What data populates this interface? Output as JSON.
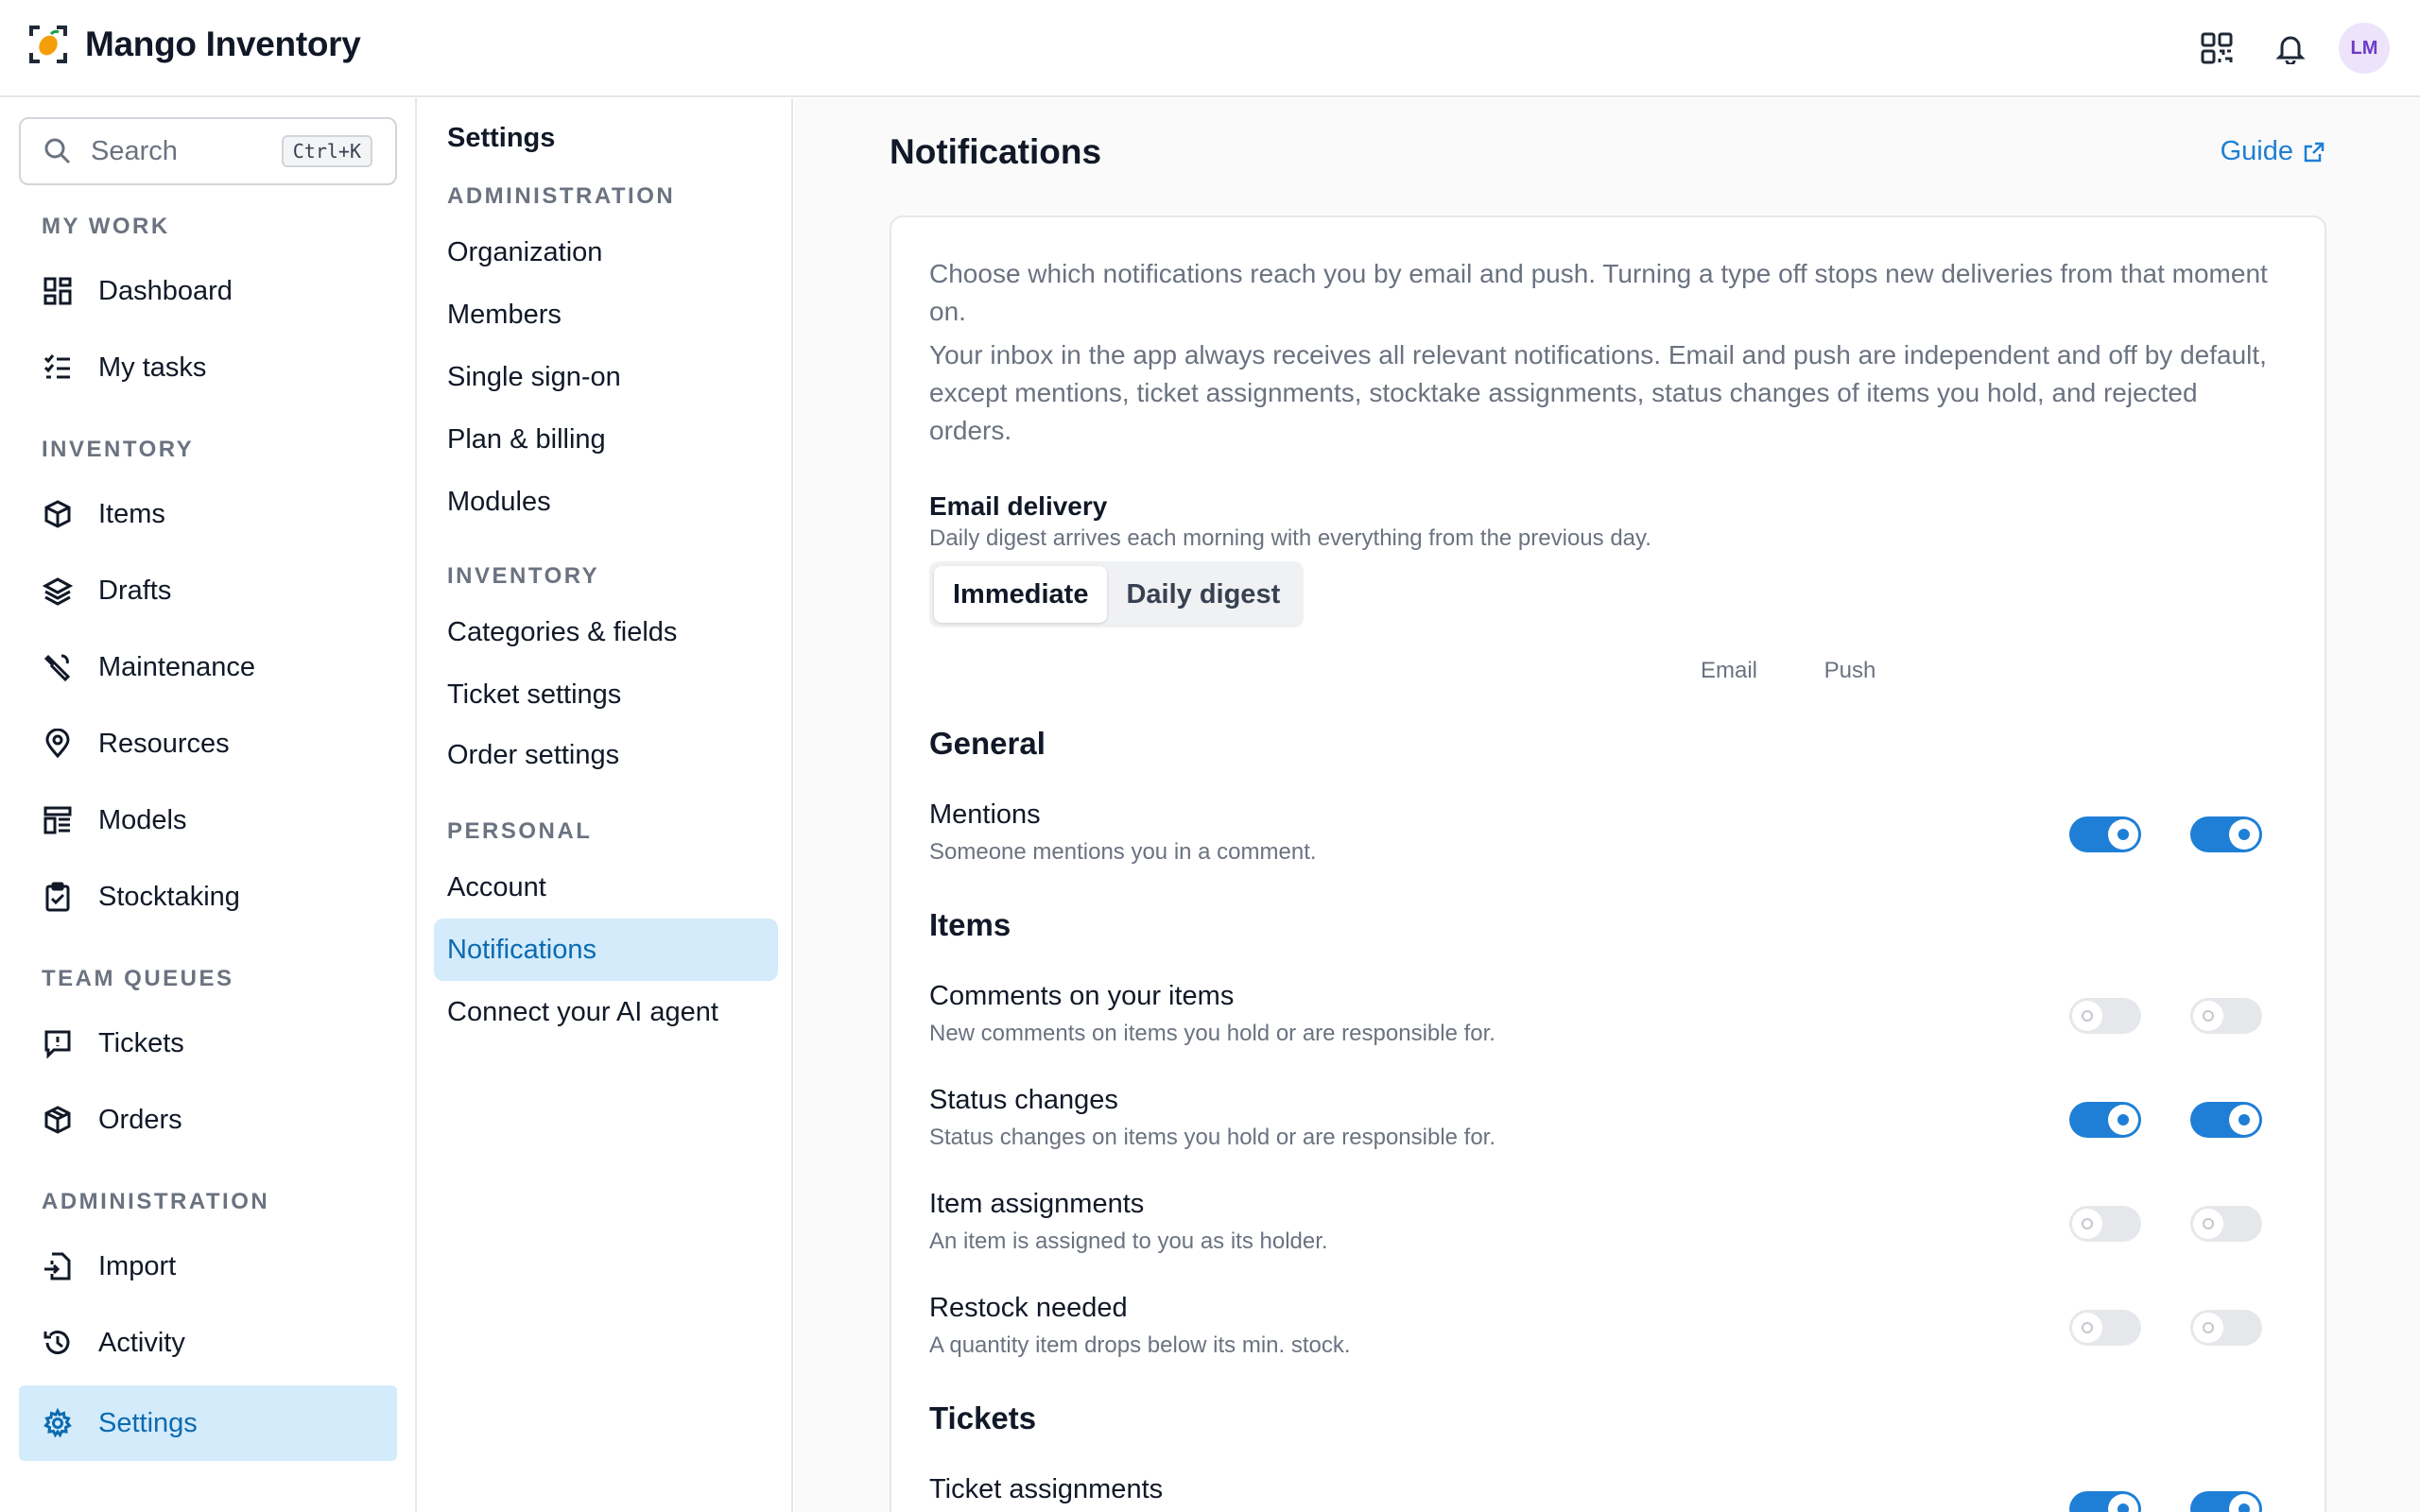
{
  "app": {
    "name": "Mango Inventory",
    "avatar_initials": "LM"
  },
  "icons": {
    "logo": "mango-logo-icon",
    "qr": "qr-code-icon",
    "bell": "bell-icon",
    "search": "search-icon",
    "external": "external-link-icon"
  },
  "colors": {
    "accent": "#1f7fd6",
    "active_bg": "#d3ebfb",
    "active_text": "#0b6bb0",
    "avatar_bg": "#ede4fb"
  },
  "search": {
    "placeholder": "Search",
    "shortcut": "Ctrl+K"
  },
  "sidebar": {
    "sections": [
      {
        "title": "MY WORK",
        "items": [
          {
            "label": "Dashboard",
            "icon": "dashboard-icon"
          },
          {
            "label": "My tasks",
            "icon": "tasks-icon"
          }
        ]
      },
      {
        "title": "INVENTORY",
        "items": [
          {
            "label": "Items",
            "icon": "cube-icon"
          },
          {
            "label": "Drafts",
            "icon": "layers-icon"
          },
          {
            "label": "Maintenance",
            "icon": "wrench-icon"
          },
          {
            "label": "Resources",
            "icon": "location-pin-icon"
          },
          {
            "label": "Models",
            "icon": "models-icon"
          },
          {
            "label": "Stocktaking",
            "icon": "clipboard-check-icon"
          }
        ]
      },
      {
        "title": "TEAM QUEUES",
        "items": [
          {
            "label": "Tickets",
            "icon": "alert-message-icon"
          },
          {
            "label": "Orders",
            "icon": "box-icon"
          }
        ]
      },
      {
        "title": "ADMINISTRATION",
        "items": [
          {
            "label": "Import",
            "icon": "import-icon"
          },
          {
            "label": "Activity",
            "icon": "history-icon"
          },
          {
            "label": "Settings",
            "icon": "gear-icon",
            "active": true
          }
        ]
      }
    ]
  },
  "subnav": {
    "title": "Settings",
    "sections": [
      {
        "title": "ADMINISTRATION",
        "items": [
          "Organization",
          "Members",
          "Single sign-on",
          "Plan & billing",
          "Modules"
        ]
      },
      {
        "title": "INVENTORY",
        "items": [
          "Categories & fields",
          "Ticket settings",
          "Order settings"
        ]
      },
      {
        "title": "PERSONAL",
        "items": [
          "Account",
          "Notifications",
          "Connect your AI agent"
        ]
      }
    ],
    "active": "Notifications"
  },
  "main": {
    "title": "Notifications",
    "guide_label": "Guide",
    "intro_1": "Choose which notifications reach you by email and push. Turning a type off stops new deliveries from that moment on.",
    "intro_2": "Your inbox in the app always receives all relevant notifications. Email and push are independent and off by default, except mentions, ticket assignments, stocktake assignments, status changes of items you hold, and rejected orders.",
    "email_delivery": {
      "label": "Email delivery",
      "help": "Daily digest arrives each morning with everything from the previous day.",
      "options": [
        "Immediate",
        "Daily digest"
      ],
      "selected": "Immediate"
    },
    "columns": {
      "email": "Email",
      "push": "Push"
    },
    "groups": [
      {
        "title": "General",
        "rows": [
          {
            "label": "Mentions",
            "help": "Someone mentions you in a comment.",
            "email": true,
            "push": true
          }
        ]
      },
      {
        "title": "Items",
        "rows": [
          {
            "label": "Comments on your items",
            "help": "New comments on items you hold or are responsible for.",
            "email": false,
            "push": false
          },
          {
            "label": "Status changes",
            "help": "Status changes on items you hold or are responsible for.",
            "email": true,
            "push": true
          },
          {
            "label": "Item assignments",
            "help": "An item is assigned to you as its holder.",
            "email": false,
            "push": false
          },
          {
            "label": "Restock needed",
            "help": "A quantity item drops below its min. stock.",
            "email": false,
            "push": false
          }
        ]
      },
      {
        "title": "Tickets",
        "rows": [
          {
            "label": "Ticket assignments",
            "help": "",
            "email": true,
            "push": true
          }
        ]
      }
    ]
  }
}
